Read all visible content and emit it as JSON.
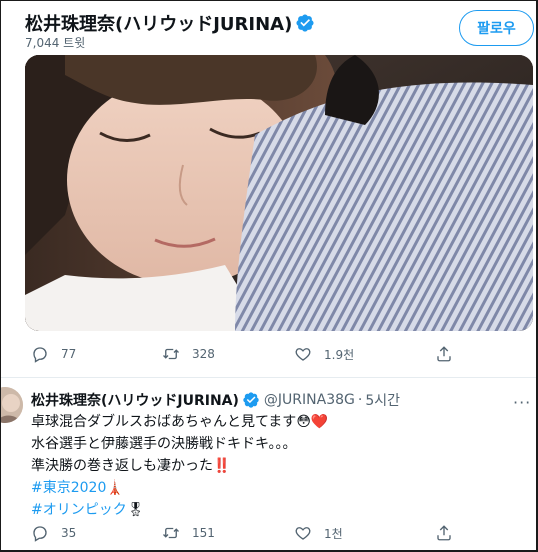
{
  "header": {
    "profile_name": "松井珠理奈(ハリウッドJURINA)",
    "tweet_count": "7,044 트윗",
    "follow_label": "팔로우"
  },
  "tweet1": {
    "actions": {
      "reply_count": "77",
      "retweet_count": "328",
      "like_count": "1.9천"
    }
  },
  "tweet2": {
    "name": "松井珠理奈(ハリウッドJURINA)",
    "handle": "@JURINA38G",
    "separator": "·",
    "time": "5시간",
    "more": "···",
    "lines": {
      "l1": "卓球混合ダブルスおばあちゃんと見てます",
      "l1_emoji": "😳❤️",
      "l2": "水谷選手と伊藤選手の決勝戦ドキドキ。。。",
      "l3": "準決勝の巻き返しも凄かった",
      "l3_emoji": "‼️",
      "hashtag1": "#東京2020",
      "hashtag1_emoji": "🗼",
      "hashtag2": "#オリンピック",
      "hashtag2_emoji": "🎖"
    },
    "actions": {
      "reply_count": "35",
      "retweet_count": "151",
      "like_count": "1천"
    }
  },
  "colors": {
    "accent": "#1d9bf0",
    "secondary_text": "#536471",
    "primary_text": "#0f1419"
  }
}
